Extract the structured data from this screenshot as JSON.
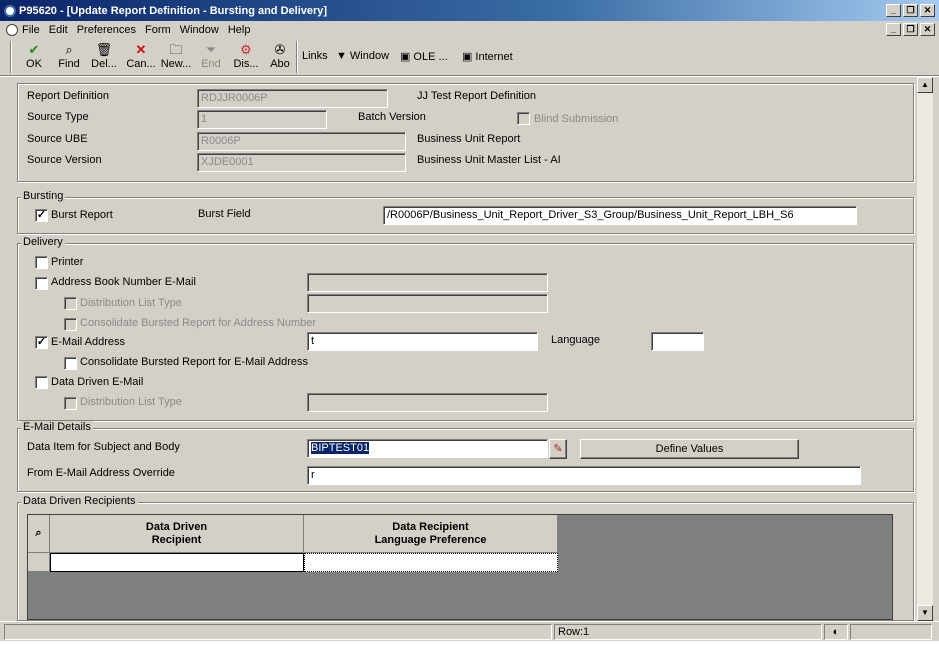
{
  "window": {
    "title": "P95620 - [Update Report Definition - Bursting and Delivery]"
  },
  "menu": [
    "File",
    "Edit",
    "Preferences",
    "Form",
    "Window",
    "Help"
  ],
  "toolbar": {
    "ok": "OK",
    "find": "Find",
    "delete": "Del...",
    "cancel": "Can...",
    "new": "New...",
    "end": "End",
    "display": "Dis...",
    "about": "Abo",
    "links": "Links",
    "window": "Window",
    "ole": "OLE ...",
    "internet": "Internet"
  },
  "header": {
    "report_definition_label": "Report Definition",
    "report_definition_value": "RDJJR0006P",
    "report_definition_desc": "JJ Test Report Definition",
    "source_type_label": "Source Type",
    "source_type_value": "1",
    "batch_version_label": "Batch Version",
    "blind_submission_label": "Blind Submission",
    "source_ube_label": "Source UBE",
    "source_ube_value": "R0006P",
    "source_ube_desc": "Business Unit Report",
    "source_version_label": "Source Version",
    "source_version_value": "XJDE0001",
    "source_version_desc": "Business Unit Master List - AI"
  },
  "bursting": {
    "section_label": "Bursting",
    "burst_report_label": "Burst Report",
    "burst_report_checked": true,
    "burst_field_label": "Burst Field",
    "burst_field_value": "/R0006P/Business_Unit_Report_Driver_S3_Group/Business_Unit_Report_LBH_S6"
  },
  "delivery": {
    "section_label": "Delivery",
    "printer_label": "Printer",
    "ab_email_label": "Address Book Number E-Mail",
    "distribution_list_label": "Distribution List Type",
    "consolidate_ab_label": "Consolidate Bursted Report for Address Number",
    "email_address_label": "E-Mail Address",
    "email_address_checked": true,
    "email_address_value": "t",
    "language_label": "Language",
    "consolidate_email_label": "Consolidate Bursted Report for E-Mail Address",
    "data_driven_label": "Data Driven E-Mail",
    "dd_distribution_list_label": "Distribution List Type"
  },
  "email_details": {
    "section_label": "E-Mail Details",
    "data_item_label": "Data Item for Subject and Body",
    "data_item_value": "BIPTEST01",
    "define_values_label": "Define Values",
    "from_override_label": "From E-Mail Address Override",
    "from_override_value": "r"
  },
  "recipients": {
    "section_label": "Data Driven Recipients",
    "col1": "Data Driven\nRecipient",
    "col2": "Data Recipient\nLanguage Preference"
  },
  "status": {
    "row": "Row:1"
  }
}
